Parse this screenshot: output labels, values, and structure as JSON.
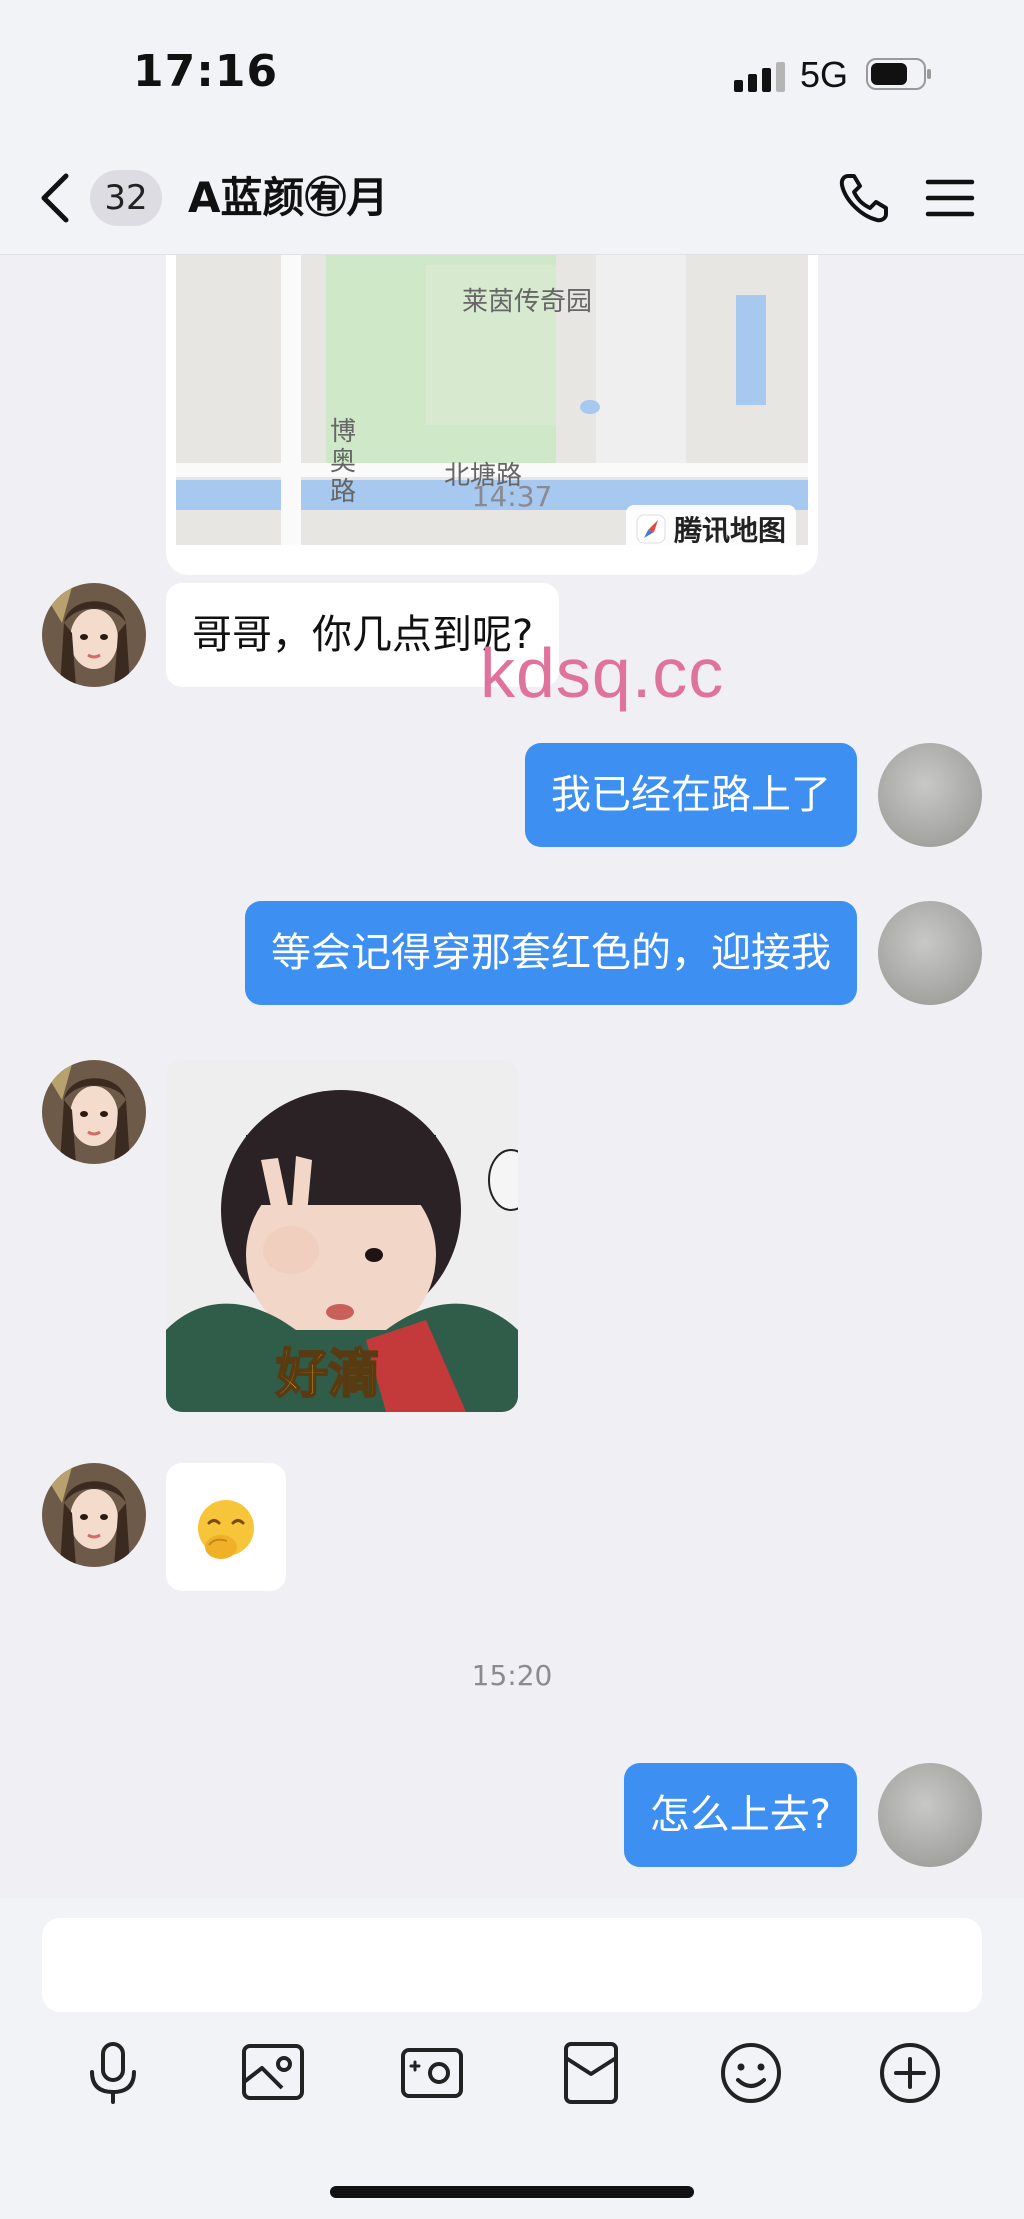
{
  "status": {
    "time": "17:16",
    "network": "5G"
  },
  "nav": {
    "unread_count": "32",
    "title": "A蓝颜㊒月"
  },
  "map": {
    "road_label": "北塘路",
    "road_vertical": "博奥路",
    "park_label": "莱茵传奇园",
    "provider": "腾讯地图"
  },
  "messages": {
    "ts1": "14:37",
    "m1": "哥哥，你几点到呢?",
    "m2": "我已经在路上了",
    "m3": "等会记得穿那套红色的，迎接我",
    "sticker_text": "好滴",
    "m5_emoji": "🤭",
    "ts2": "15:20",
    "m6": "怎么上去?"
  },
  "watermark": "kdsq.cc",
  "toolbar": [
    "mic-icon",
    "image-icon",
    "camera-icon",
    "red-packet-icon",
    "emoji-icon",
    "plus-icon"
  ],
  "colors": {
    "outgoing_bubble": "#3d8ff2",
    "incoming_bubble": "#ffffff",
    "background": "#efeff4"
  }
}
